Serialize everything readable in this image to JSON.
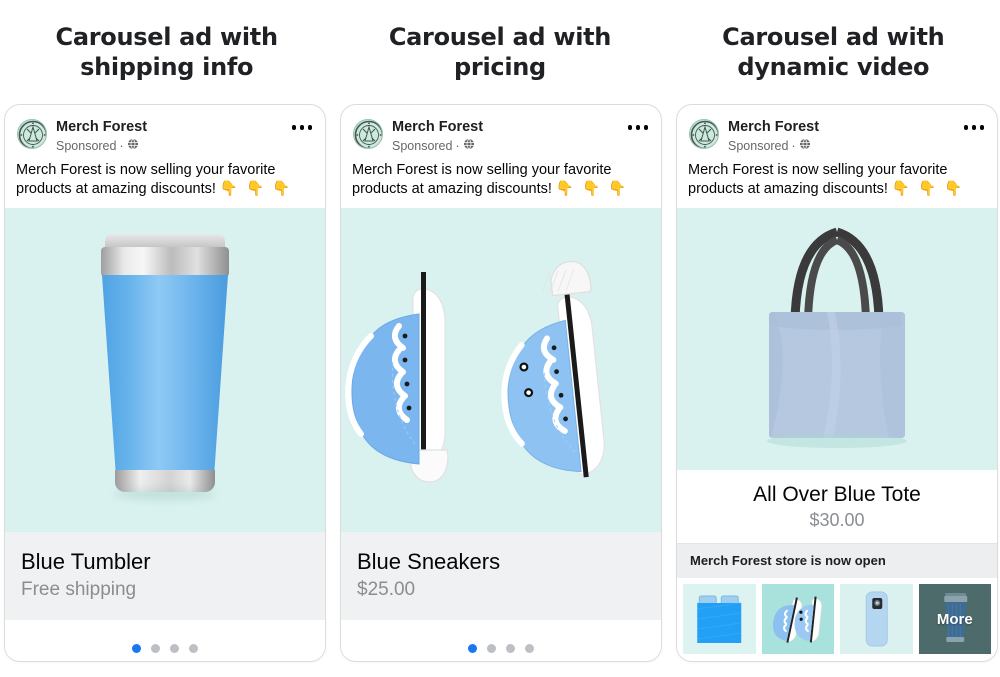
{
  "page": {
    "background_color": "#ffffff"
  },
  "columns": [
    {
      "heading": "Carousel ad with shipping info",
      "card": {
        "advertiser": "Merch Forest",
        "sponsored_label": "Sponsored",
        "separator": "·",
        "audience_icon": "globe-icon",
        "menu_icon": "more-options-icon",
        "body_text": "Merch Forest is now selling your favorite products at amazing discounts!",
        "body_emoji": "👇 👇 👇",
        "media_type": "product-image-tumbler",
        "media_background": "#d9f2ef",
        "product_title": "Blue Tumbler",
        "product_subtitle": "Free shipping",
        "dots": {
          "count": 4,
          "active_index": 0,
          "active_color": "#1877f2",
          "inactive_color": "#bcc0c4"
        }
      }
    },
    {
      "heading": "Carousel ad with pricing",
      "card": {
        "advertiser": "Merch Forest",
        "sponsored_label": "Sponsored",
        "separator": "·",
        "audience_icon": "globe-icon",
        "menu_icon": "more-options-icon",
        "body_text": "Merch Forest is now selling your favorite products at amazing discounts!",
        "body_emoji": "👇 👇 👇",
        "media_type": "product-image-sneakers",
        "media_background": "#d9f2ef",
        "product_title": "Blue Sneakers",
        "product_subtitle": "$25.00",
        "dots": {
          "count": 4,
          "active_index": 0,
          "active_color": "#1877f2",
          "inactive_color": "#bcc0c4"
        }
      }
    },
    {
      "heading": "Carousel ad with dynamic video",
      "card": {
        "advertiser": "Merch Forest",
        "sponsored_label": "Sponsored",
        "separator": "·",
        "audience_icon": "globe-icon",
        "menu_icon": "more-options-icon",
        "body_text": "Merch Forest is now selling your favorite products at amazing discounts!",
        "body_emoji": "👇 👇 👇",
        "media_type": "product-image-tote",
        "media_background": "#d9f2ef",
        "product_title": "All Over Blue Tote",
        "product_subtitle": "$30.00",
        "store_bar_text": "Merch Forest store is now open",
        "thumbnails": [
          {
            "label": "",
            "item": "bedding-set-thumbnail",
            "background": "#ddf3f1"
          },
          {
            "label": "",
            "item": "sneakers-thumbnail",
            "background": "#a9e2dd"
          },
          {
            "label": "",
            "item": "phone-case-thumbnail",
            "background": "#daf1f0"
          },
          {
            "label": "More",
            "item": "tumbler-thumbnail-more",
            "background": "#4e6b6b"
          }
        ]
      }
    }
  ]
}
